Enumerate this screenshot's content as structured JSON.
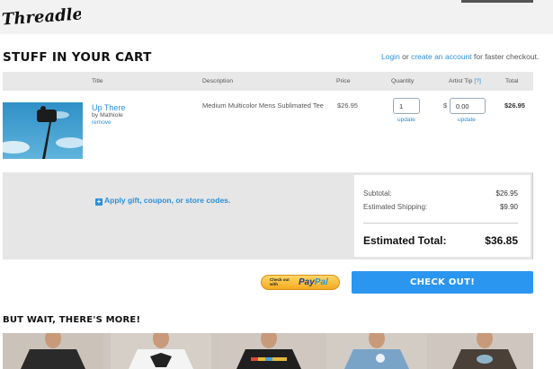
{
  "brand": {
    "logo_text": "Threadless"
  },
  "cart": {
    "title": "STUFF IN YOUR CART",
    "login_prompt": {
      "login": "Login",
      "or": " or ",
      "create": "create an account",
      "suffix": " for faster checkout."
    },
    "columns": {
      "title": "Title",
      "description": "Description",
      "price": "Price",
      "quantity": "Quantity",
      "artist_tip": "Artist Tip",
      "help": "[?]",
      "total": "Total"
    },
    "item": {
      "name": "Up There",
      "by": "by Mathiole",
      "remove": "remove",
      "description": "Medium Multicolor Mens Sublimated Tee",
      "price": "$26.95",
      "quantity": "1",
      "update_label": "update",
      "currency_symbol": "$",
      "tip": "0.00",
      "total": "$26.95"
    }
  },
  "promo": {
    "label": "Apply gift, coupon, or store codes.",
    "icon": "plus-icon"
  },
  "summary": {
    "subtotal_label": "Subtotal:",
    "subtotal": "$26.95",
    "shipping_label": "Estimated Shipping:",
    "shipping": "$9.90",
    "total_label": "Estimated Total:",
    "total": "$36.85"
  },
  "paypal": {
    "small_line1": "Check out",
    "small_line2": "with",
    "brand_a": "Pay",
    "brand_b": "Pal"
  },
  "checkout_button": "CHECK OUT!",
  "more": {
    "title": "BUT WAIT, THERE'S MORE!",
    "shirts": [
      {
        "icon": "tshirt-black",
        "color": "#2a2a2a"
      },
      {
        "icon": "tshirt-white",
        "color": "#f4f4f4"
      },
      {
        "icon": "tshirt-black",
        "color": "#1f1f1f"
      },
      {
        "icon": "tshirt-blue",
        "color": "#7aa3c8"
      },
      {
        "icon": "tshirt-brown",
        "color": "#4a4038"
      }
    ]
  },
  "colors": {
    "accent": "#2b96ef",
    "link": "#2b8fd9",
    "panel": "#e6e6e6"
  }
}
